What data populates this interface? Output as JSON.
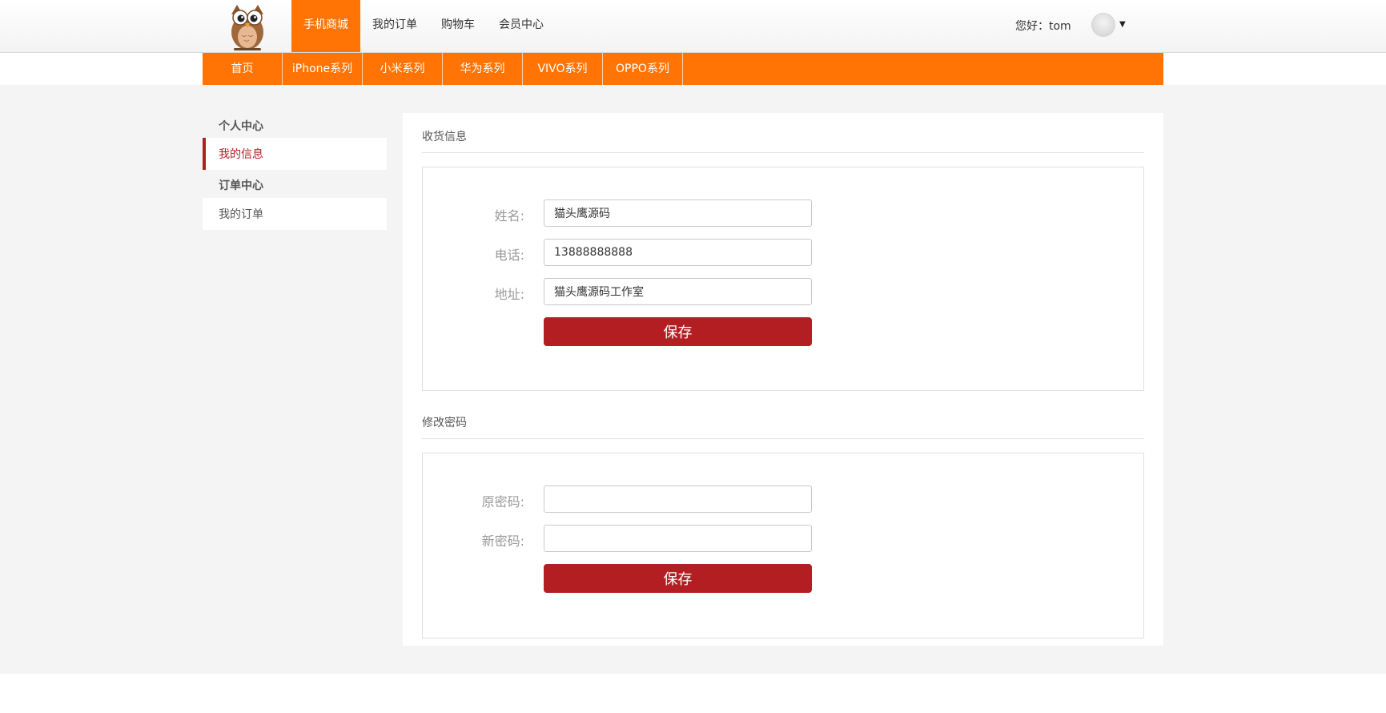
{
  "header": {
    "logo": "owl-logo",
    "nav": [
      {
        "label": "手机商城",
        "active": true
      },
      {
        "label": "我的订单",
        "active": false
      },
      {
        "label": "购物车",
        "active": false
      },
      {
        "label": "会员中心",
        "active": false
      }
    ],
    "greeting": "您好：tom",
    "avatar_icon": "user-avatar-icon",
    "caret_icon": "caret-down-icon"
  },
  "categories": [
    "首页",
    "iPhone系列",
    "小米系列",
    "华为系列",
    "VIVO系列",
    "OPPO系列"
  ],
  "sidebar": {
    "groups": [
      {
        "title": "个人中心",
        "items": [
          {
            "label": "我的信息",
            "active": true
          }
        ]
      },
      {
        "title": "订单中心",
        "items": [
          {
            "label": "我的订单",
            "active": false
          }
        ]
      }
    ]
  },
  "shipping": {
    "title": "收货信息",
    "name_label": "姓名:",
    "name_value": "猫头鹰源码",
    "phone_label": "电话:",
    "phone_value": "13888888888",
    "address_label": "地址:",
    "address_value": "猫头鹰源码工作室",
    "save_label": "保存"
  },
  "password": {
    "title": "修改密码",
    "old_label": "原密码:",
    "old_value": "",
    "new_label": "新密码:",
    "new_value": "",
    "save_label": "保存"
  },
  "colors": {
    "accent_orange": "#ff7404",
    "button_red": "#b31e22",
    "page_bg": "#f4f4f4"
  }
}
